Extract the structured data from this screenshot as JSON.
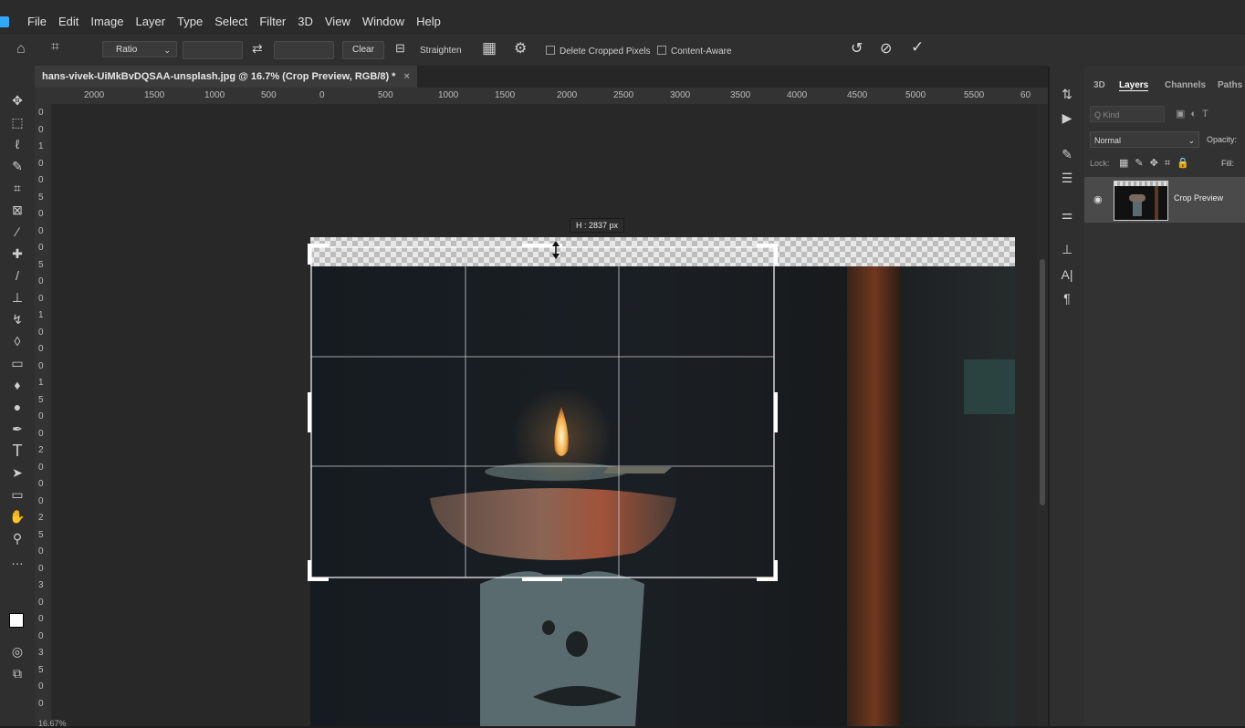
{
  "menu": [
    "File",
    "Edit",
    "Image",
    "Layer",
    "Type",
    "Select",
    "Filter",
    "3D",
    "View",
    "Window",
    "Help"
  ],
  "options": {
    "ratio_label": "Ratio",
    "clear_label": "Clear",
    "straighten_label": "Straighten",
    "delete_cropped_label": "Delete Cropped Pixels",
    "content_aware_label": "Content-Aware"
  },
  "document": {
    "tab_title": "hans-vivek-UiMkBvDQSAA-unsplash.jpg @ 16.7% (Crop Preview, RGB/8) *",
    "close_glyph": "×",
    "zoom": "16.67%"
  },
  "ruler": {
    "top_labels": [
      "2000",
      "1500",
      "1000",
      "500",
      "0",
      "500",
      "1000",
      "1500",
      "2000",
      "2500",
      "3000",
      "3500",
      "4000",
      "4500",
      "5000",
      "5500",
      "60"
    ],
    "left_labels": [
      "0",
      "0",
      "1",
      "0",
      "0",
      "5",
      "0",
      "0",
      "0",
      "5",
      "0",
      "0",
      "1",
      "0",
      "0",
      "0",
      "1",
      "5",
      "0",
      "0",
      "2",
      "0",
      "0",
      "0",
      "2",
      "5",
      "0",
      "0",
      "3",
      "0",
      "0",
      "0",
      "3",
      "5",
      "0",
      "0"
    ]
  },
  "crop": {
    "tooltip": "H : 2837 px"
  },
  "panel": {
    "tabs": [
      "3D",
      "Layers",
      "Channels",
      "Paths"
    ],
    "active_tab": "Layers",
    "kind_placeholder": "Q Kind",
    "blend_mode": "Normal",
    "opacity_label": "Opacity:",
    "lock_label": "Lock:",
    "fill_label": "Fill:",
    "layers": [
      {
        "name": "Crop Preview"
      }
    ]
  },
  "colors": {
    "accent": "#31a8ff",
    "panel_bg": "#323232",
    "canvas_bg": "#282828"
  }
}
